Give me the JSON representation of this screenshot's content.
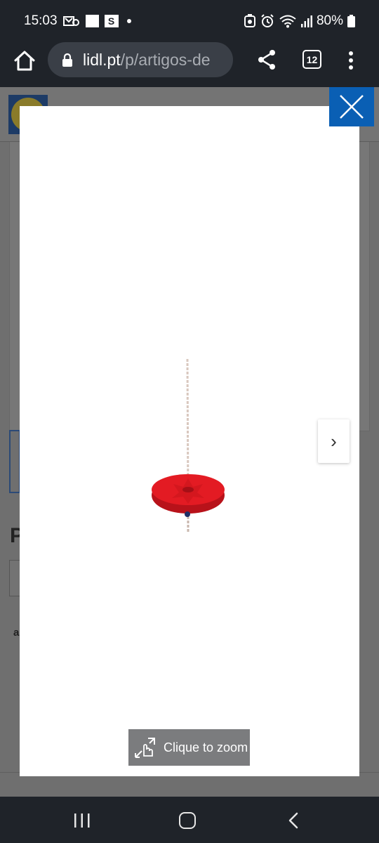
{
  "status_bar": {
    "time": "15:03",
    "s_icon_label": "S",
    "battery": "80%"
  },
  "browser": {
    "url_domain": "lidl.pt",
    "url_path": "/p/artigos-de",
    "tab_count": "12"
  },
  "modal": {
    "image_alt": "Disco de baloiço vermelho com corda",
    "next_symbol": "›",
    "zoom_hint": "Clique to zoom"
  },
  "colors": {
    "status_bg": "#1f2329",
    "url_pill_bg": "#3a3f47",
    "close_button_bg": "#0a5fb4",
    "zoom_hint_bg": "#7b7c7e",
    "swing_red": "#e31b23",
    "overlay_dim": "#6f6f6f"
  },
  "icons": {
    "home": "home-icon",
    "lock": "lock-icon",
    "share": "share-icon",
    "menu": "more-vert-icon",
    "close": "close-icon",
    "next": "chevron-right-icon",
    "zoom": "tap-zoom-icon",
    "nav_recents": "recents-icon",
    "nav_home": "home-circle-icon",
    "nav_back": "back-icon"
  }
}
